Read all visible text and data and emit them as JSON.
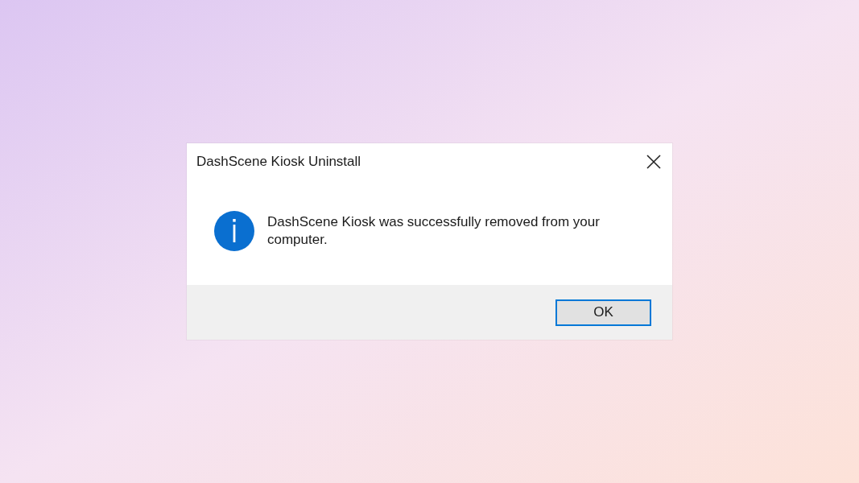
{
  "dialog": {
    "title": "DashScene Kiosk Uninstall",
    "message": "DashScene Kiosk was successfully removed from your computer.",
    "buttons": [
      {
        "label": "OK",
        "default": true
      }
    ]
  }
}
